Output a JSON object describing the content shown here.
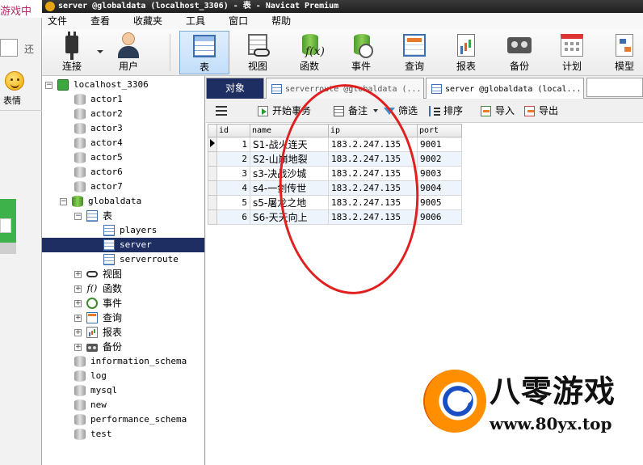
{
  "background_window": {
    "title_fragment": "游戏中",
    "button_fragment": "还",
    "emoji_label": "表情"
  },
  "window": {
    "title": "server @globaldata (localhost_3306) - 表 - Navicat Premium"
  },
  "menu": [
    "文件",
    "查看",
    "收藏夹",
    "工具",
    "窗口",
    "帮助"
  ],
  "toolbar": [
    {
      "label": "连接",
      "icon": "connection-plug-icon"
    },
    {
      "label": "用户",
      "icon": "user-icon"
    },
    {
      "label": "表",
      "icon": "table-icon",
      "selected": true
    },
    {
      "label": "视图",
      "icon": "view-icon"
    },
    {
      "label": "函数",
      "icon": "function-icon"
    },
    {
      "label": "事件",
      "icon": "event-icon"
    },
    {
      "label": "查询",
      "icon": "query-icon"
    },
    {
      "label": "报表",
      "icon": "report-icon"
    },
    {
      "label": "备份",
      "icon": "backup-icon"
    },
    {
      "label": "计划",
      "icon": "schedule-icon"
    },
    {
      "label": "模型",
      "icon": "model-icon"
    }
  ],
  "tree": {
    "connection": "localhost_3306",
    "databases_before": [
      "actor1",
      "actor2",
      "actor3",
      "actor4",
      "actor5",
      "actor6",
      "actor7"
    ],
    "active_db": "globaldata",
    "tables_group": "表",
    "tables": [
      "players",
      "server",
      "serverroute"
    ],
    "selected_table": "server",
    "groups": [
      {
        "label": "视图",
        "icon": "view-icon"
      },
      {
        "label": "函数",
        "icon": "function-icon"
      },
      {
        "label": "事件",
        "icon": "event-icon"
      },
      {
        "label": "查询",
        "icon": "query-icon"
      },
      {
        "label": "报表",
        "icon": "report-icon"
      },
      {
        "label": "备份",
        "icon": "backup-icon"
      }
    ],
    "databases_after": [
      "information_schema",
      "log",
      "mysql",
      "new",
      "performance_schema",
      "test"
    ]
  },
  "tabs": [
    {
      "label": "对象"
    },
    {
      "label": "serverroute @globaldata (..."
    },
    {
      "label": "server @globaldata (local..."
    }
  ],
  "content_toolbar": {
    "begin_transaction": "开始事务",
    "note": "备注",
    "filter": "筛选",
    "sort": "排序",
    "import": "导入",
    "export": "导出"
  },
  "grid": {
    "columns": [
      "id",
      "name",
      "ip",
      "port"
    ],
    "rows": [
      [
        "1",
        "S1-战火连天",
        "183.2.247.135",
        "9001"
      ],
      [
        "2",
        "S2-山崩地裂",
        "183.2.247.135",
        "9002"
      ],
      [
        "3",
        "s3-决战沙城",
        "183.2.247.135",
        "9003"
      ],
      [
        "4",
        "s4-一剑传世",
        "183.2.247.135",
        "9004"
      ],
      [
        "5",
        "s5-屠龙之地",
        "183.2.247.135",
        "9005"
      ],
      [
        "6",
        "S6-天天向上",
        "183.2.247.135",
        "9006"
      ]
    ]
  },
  "watermark": {
    "title": "八零游戏",
    "url": "www.80yx.top"
  },
  "colors": {
    "selection": "#1e2e63",
    "annotation": "#e01f1f",
    "accent": "#3d6fb0"
  }
}
